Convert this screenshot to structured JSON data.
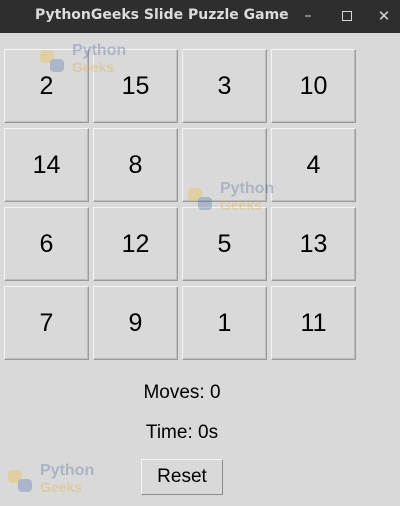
{
  "window": {
    "title": "PythonGeeks Slide Puzzle Game",
    "controls": {
      "minimize": "–",
      "close": "✕"
    }
  },
  "board": {
    "rows": [
      [
        "2",
        "15",
        "3",
        "10"
      ],
      [
        "14",
        "8",
        "",
        "4"
      ],
      [
        "6",
        "12",
        "5",
        "13"
      ],
      [
        "7",
        "9",
        "1",
        "11"
      ]
    ]
  },
  "status": {
    "moves": "Moves: 0",
    "time": "Time: 0s"
  },
  "actions": {
    "reset_label": "Reset"
  },
  "watermark": {
    "line1": "Python",
    "line2": "Geeks"
  },
  "colors": {
    "background": "#d9d9d9",
    "titlebar": "#2e2e2e"
  }
}
